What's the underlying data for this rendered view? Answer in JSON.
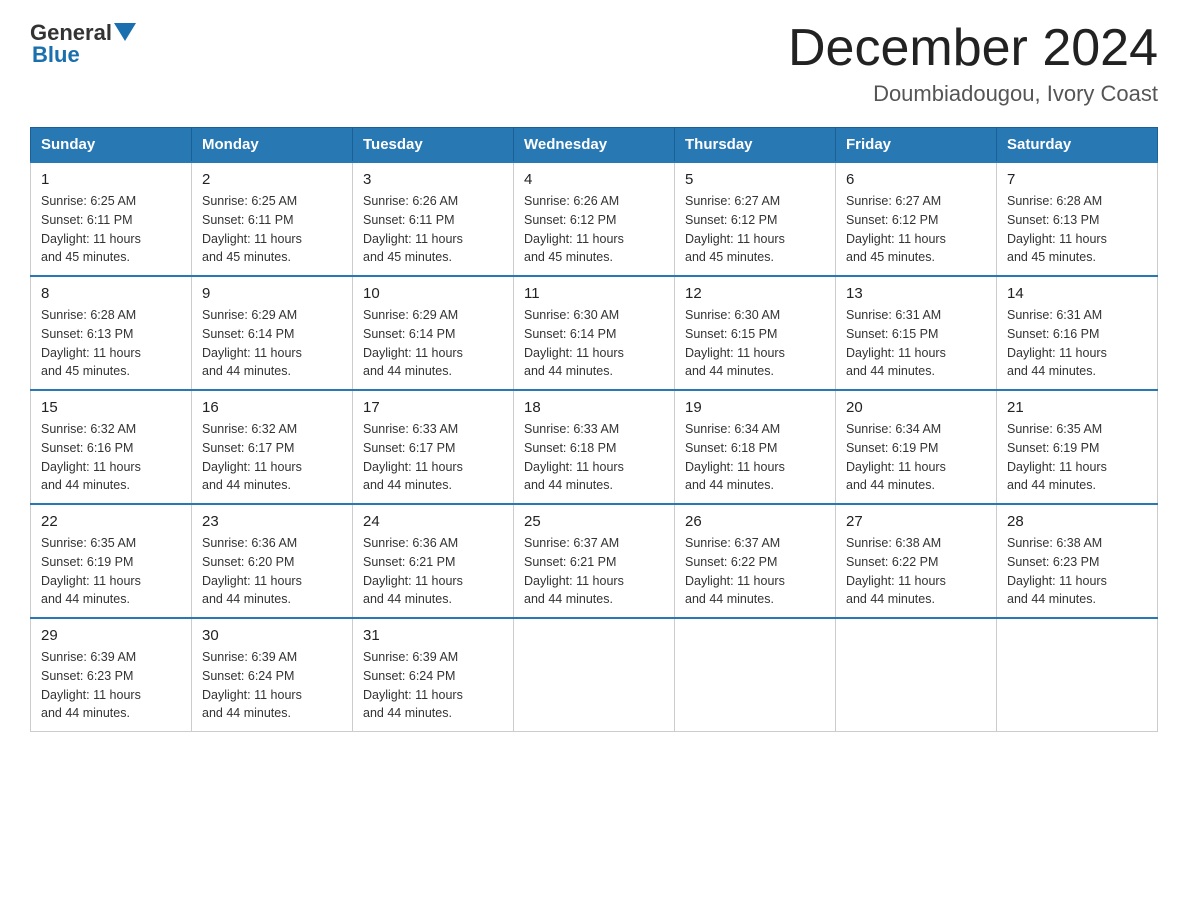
{
  "logo": {
    "text_general": "General",
    "text_blue": "Blue",
    "aria": "GeneralBlue logo"
  },
  "header": {
    "month": "December 2024",
    "location": "Doumbiadougou, Ivory Coast"
  },
  "days_of_week": [
    "Sunday",
    "Monday",
    "Tuesday",
    "Wednesday",
    "Thursday",
    "Friday",
    "Saturday"
  ],
  "weeks": [
    [
      {
        "day": "1",
        "sunrise": "6:25 AM",
        "sunset": "6:11 PM",
        "daylight": "11 hours and 45 minutes."
      },
      {
        "day": "2",
        "sunrise": "6:25 AM",
        "sunset": "6:11 PM",
        "daylight": "11 hours and 45 minutes."
      },
      {
        "day": "3",
        "sunrise": "6:26 AM",
        "sunset": "6:11 PM",
        "daylight": "11 hours and 45 minutes."
      },
      {
        "day": "4",
        "sunrise": "6:26 AM",
        "sunset": "6:12 PM",
        "daylight": "11 hours and 45 minutes."
      },
      {
        "day": "5",
        "sunrise": "6:27 AM",
        "sunset": "6:12 PM",
        "daylight": "11 hours and 45 minutes."
      },
      {
        "day": "6",
        "sunrise": "6:27 AM",
        "sunset": "6:12 PM",
        "daylight": "11 hours and 45 minutes."
      },
      {
        "day": "7",
        "sunrise": "6:28 AM",
        "sunset": "6:13 PM",
        "daylight": "11 hours and 45 minutes."
      }
    ],
    [
      {
        "day": "8",
        "sunrise": "6:28 AM",
        "sunset": "6:13 PM",
        "daylight": "11 hours and 45 minutes."
      },
      {
        "day": "9",
        "sunrise": "6:29 AM",
        "sunset": "6:14 PM",
        "daylight": "11 hours and 44 minutes."
      },
      {
        "day": "10",
        "sunrise": "6:29 AM",
        "sunset": "6:14 PM",
        "daylight": "11 hours and 44 minutes."
      },
      {
        "day": "11",
        "sunrise": "6:30 AM",
        "sunset": "6:14 PM",
        "daylight": "11 hours and 44 minutes."
      },
      {
        "day": "12",
        "sunrise": "6:30 AM",
        "sunset": "6:15 PM",
        "daylight": "11 hours and 44 minutes."
      },
      {
        "day": "13",
        "sunrise": "6:31 AM",
        "sunset": "6:15 PM",
        "daylight": "11 hours and 44 minutes."
      },
      {
        "day": "14",
        "sunrise": "6:31 AM",
        "sunset": "6:16 PM",
        "daylight": "11 hours and 44 minutes."
      }
    ],
    [
      {
        "day": "15",
        "sunrise": "6:32 AM",
        "sunset": "6:16 PM",
        "daylight": "11 hours and 44 minutes."
      },
      {
        "day": "16",
        "sunrise": "6:32 AM",
        "sunset": "6:17 PM",
        "daylight": "11 hours and 44 minutes."
      },
      {
        "day": "17",
        "sunrise": "6:33 AM",
        "sunset": "6:17 PM",
        "daylight": "11 hours and 44 minutes."
      },
      {
        "day": "18",
        "sunrise": "6:33 AM",
        "sunset": "6:18 PM",
        "daylight": "11 hours and 44 minutes."
      },
      {
        "day": "19",
        "sunrise": "6:34 AM",
        "sunset": "6:18 PM",
        "daylight": "11 hours and 44 minutes."
      },
      {
        "day": "20",
        "sunrise": "6:34 AM",
        "sunset": "6:19 PM",
        "daylight": "11 hours and 44 minutes."
      },
      {
        "day": "21",
        "sunrise": "6:35 AM",
        "sunset": "6:19 PM",
        "daylight": "11 hours and 44 minutes."
      }
    ],
    [
      {
        "day": "22",
        "sunrise": "6:35 AM",
        "sunset": "6:19 PM",
        "daylight": "11 hours and 44 minutes."
      },
      {
        "day": "23",
        "sunrise": "6:36 AM",
        "sunset": "6:20 PM",
        "daylight": "11 hours and 44 minutes."
      },
      {
        "day": "24",
        "sunrise": "6:36 AM",
        "sunset": "6:21 PM",
        "daylight": "11 hours and 44 minutes."
      },
      {
        "day": "25",
        "sunrise": "6:37 AM",
        "sunset": "6:21 PM",
        "daylight": "11 hours and 44 minutes."
      },
      {
        "day": "26",
        "sunrise": "6:37 AM",
        "sunset": "6:22 PM",
        "daylight": "11 hours and 44 minutes."
      },
      {
        "day": "27",
        "sunrise": "6:38 AM",
        "sunset": "6:22 PM",
        "daylight": "11 hours and 44 minutes."
      },
      {
        "day": "28",
        "sunrise": "6:38 AM",
        "sunset": "6:23 PM",
        "daylight": "11 hours and 44 minutes."
      }
    ],
    [
      {
        "day": "29",
        "sunrise": "6:39 AM",
        "sunset": "6:23 PM",
        "daylight": "11 hours and 44 minutes."
      },
      {
        "day": "30",
        "sunrise": "6:39 AM",
        "sunset": "6:24 PM",
        "daylight": "11 hours and 44 minutes."
      },
      {
        "day": "31",
        "sunrise": "6:39 AM",
        "sunset": "6:24 PM",
        "daylight": "11 hours and 44 minutes."
      },
      null,
      null,
      null,
      null
    ]
  ],
  "labels": {
    "sunrise": "Sunrise:",
    "sunset": "Sunset:",
    "daylight": "Daylight:"
  }
}
